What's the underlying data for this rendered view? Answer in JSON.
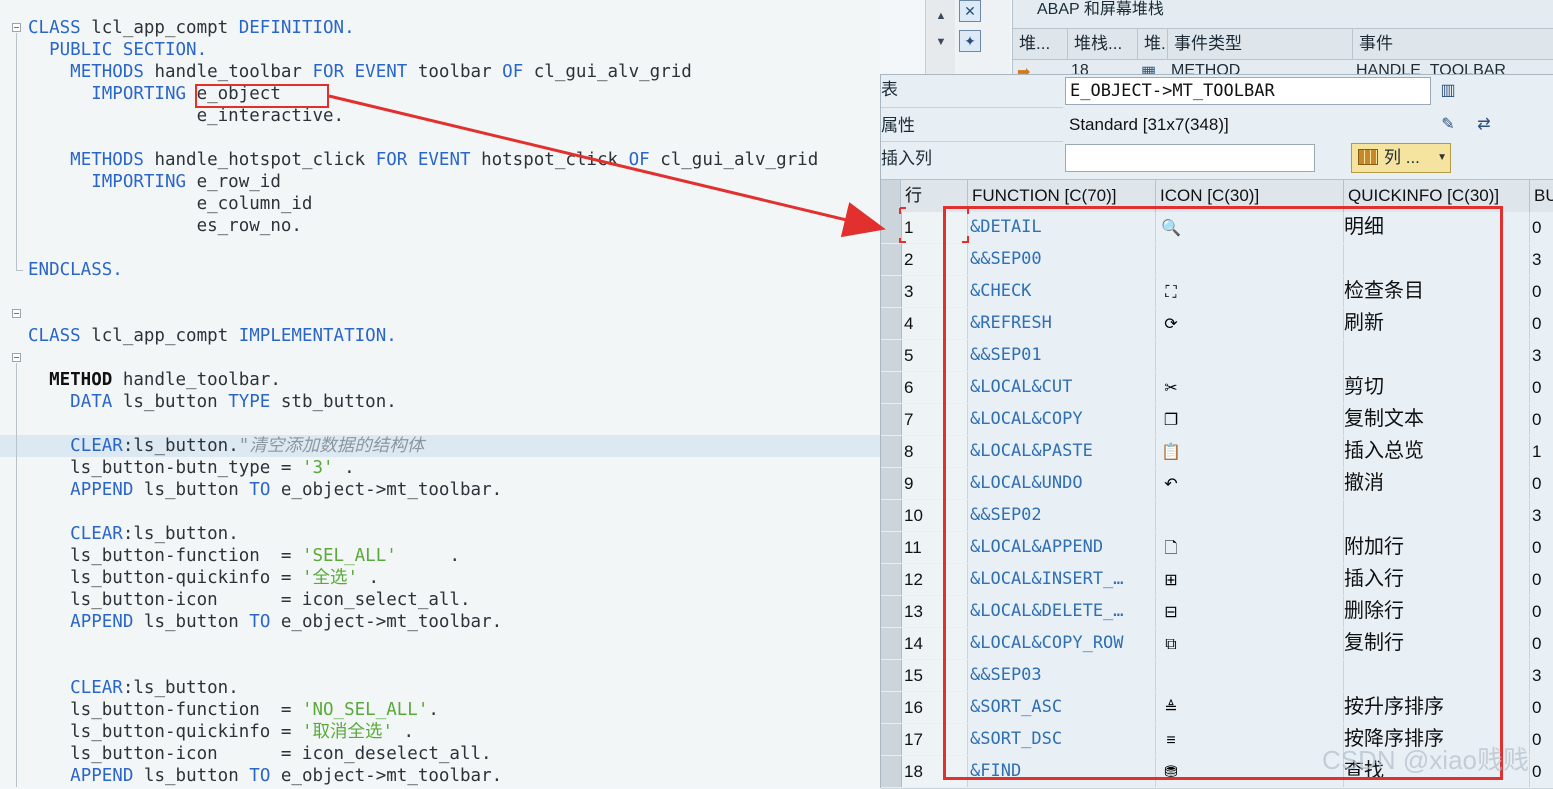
{
  "code": {
    "lines": [
      {
        "parts": [
          [
            "kw",
            "CLASS "
          ],
          [
            "plain",
            "lcl_app_compt "
          ],
          [
            "kw",
            "DEFINITION."
          ]
        ]
      },
      {
        "parts": [
          [
            "plain",
            "  "
          ],
          [
            "kw",
            "PUBLIC SECTION."
          ]
        ]
      },
      {
        "parts": [
          [
            "plain",
            "    "
          ],
          [
            "kw",
            "METHODS "
          ],
          [
            "plain",
            "handle_toolbar "
          ],
          [
            "kw",
            "FOR EVENT "
          ],
          [
            "plain",
            "toolbar "
          ],
          [
            "kw",
            "OF "
          ],
          [
            "plain",
            "cl_gui_alv_grid"
          ]
        ]
      },
      {
        "parts": [
          [
            "plain",
            "      "
          ],
          [
            "kw",
            "IMPORTING "
          ],
          [
            "plain",
            "e_object"
          ]
        ]
      },
      {
        "parts": [
          [
            "plain",
            "                e_interactive."
          ]
        ]
      },
      {
        "parts": [
          [
            "plain",
            ""
          ]
        ]
      },
      {
        "parts": [
          [
            "plain",
            "    "
          ],
          [
            "kw",
            "METHODS "
          ],
          [
            "plain",
            "handle_hotspot_click "
          ],
          [
            "kw",
            "FOR EVENT "
          ],
          [
            "plain",
            "hotspot_click "
          ],
          [
            "kw",
            "OF "
          ],
          [
            "plain",
            "cl_gui_alv_grid"
          ]
        ]
      },
      {
        "parts": [
          [
            "plain",
            "      "
          ],
          [
            "kw",
            "IMPORTING "
          ],
          [
            "plain",
            "e_row_id"
          ]
        ]
      },
      {
        "parts": [
          [
            "plain",
            "                e_column_id"
          ]
        ]
      },
      {
        "parts": [
          [
            "plain",
            "                es_row_no."
          ]
        ]
      },
      {
        "parts": [
          [
            "plain",
            ""
          ]
        ]
      },
      {
        "parts": [
          [
            "kw",
            "ENDCLASS."
          ]
        ]
      },
      {
        "parts": [
          [
            "plain",
            ""
          ]
        ]
      },
      {
        "parts": [
          [
            "plain",
            ""
          ]
        ]
      },
      {
        "parts": [
          [
            "kw",
            "CLASS "
          ],
          [
            "plain",
            "lcl_app_compt "
          ],
          [
            "kw",
            "IMPLEMENTATION."
          ]
        ]
      },
      {
        "parts": [
          [
            "plain",
            ""
          ]
        ]
      },
      {
        "parts": [
          [
            "plain",
            "  "
          ],
          [
            "bold",
            "METHOD "
          ],
          [
            "plain",
            "handle_toolbar."
          ]
        ]
      },
      {
        "parts": [
          [
            "plain",
            "    "
          ],
          [
            "kw",
            "DATA "
          ],
          [
            "plain",
            "ls_button "
          ],
          [
            "kw",
            "TYPE "
          ],
          [
            "plain",
            "stb_button."
          ]
        ]
      },
      {
        "parts": [
          [
            "plain",
            ""
          ]
        ]
      },
      {
        "parts": [
          [
            "plain",
            "    "
          ],
          [
            "kw",
            "CLEAR"
          ],
          [
            "plain",
            ":ls_button."
          ],
          [
            "cmt",
            "\"清空添加数据的结构体"
          ]
        ],
        "hl": true
      },
      {
        "parts": [
          [
            "plain",
            "    ls_button-butn_type = "
          ],
          [
            "str",
            "'3'"
          ],
          [
            "plain",
            " ."
          ]
        ]
      },
      {
        "parts": [
          [
            "plain",
            "    "
          ],
          [
            "kw",
            "APPEND "
          ],
          [
            "plain",
            "ls_button "
          ],
          [
            "kw",
            "TO "
          ],
          [
            "plain",
            "e_object->mt_toolbar."
          ]
        ]
      },
      {
        "parts": [
          [
            "plain",
            ""
          ]
        ]
      },
      {
        "parts": [
          [
            "plain",
            "    "
          ],
          [
            "kw",
            "CLEAR"
          ],
          [
            "plain",
            ":ls_button."
          ]
        ]
      },
      {
        "parts": [
          [
            "plain",
            "    ls_button-function  = "
          ],
          [
            "str",
            "'SEL_ALL'"
          ],
          [
            "plain",
            "     ."
          ]
        ]
      },
      {
        "parts": [
          [
            "plain",
            "    ls_button-quickinfo = "
          ],
          [
            "str",
            "'全选'"
          ],
          [
            "plain",
            " ."
          ]
        ]
      },
      {
        "parts": [
          [
            "plain",
            "    ls_button-icon      = icon_select_all."
          ]
        ]
      },
      {
        "parts": [
          [
            "plain",
            "    "
          ],
          [
            "kw",
            "APPEND "
          ],
          [
            "plain",
            "ls_button "
          ],
          [
            "kw",
            "TO "
          ],
          [
            "plain",
            "e_object->mt_toolbar."
          ]
        ]
      },
      {
        "parts": [
          [
            "plain",
            ""
          ]
        ]
      },
      {
        "parts": [
          [
            "plain",
            ""
          ]
        ]
      },
      {
        "parts": [
          [
            "plain",
            "    "
          ],
          [
            "kw",
            "CLEAR"
          ],
          [
            "plain",
            ":ls_button."
          ]
        ]
      },
      {
        "parts": [
          [
            "plain",
            "    ls_button-function  = "
          ],
          [
            "str",
            "'NO_SEL_ALL'"
          ],
          [
            "plain",
            "."
          ]
        ]
      },
      {
        "parts": [
          [
            "plain",
            "    ls_button-quickinfo = "
          ],
          [
            "str",
            "'取消全选'"
          ],
          [
            "plain",
            " ."
          ]
        ]
      },
      {
        "parts": [
          [
            "plain",
            "    ls_button-icon      = icon_deselect_all."
          ]
        ]
      },
      {
        "parts": [
          [
            "plain",
            "    "
          ],
          [
            "kw",
            "APPEND "
          ],
          [
            "plain",
            "ls_button "
          ],
          [
            "kw",
            "TO "
          ],
          [
            "plain",
            "e_object->mt_toolbar."
          ]
        ]
      }
    ]
  },
  "stack": {
    "title": "ABAP 和屏幕堆栈",
    "headers": [
      "堆...",
      "堆栈...",
      "堆.",
      "事件类型",
      "事件"
    ],
    "row": [
      "18",
      "METHOD",
      "HANDLE_TOOLBAR"
    ]
  },
  "viewer": {
    "label_table": "表",
    "table_name": "E_OBJECT->MT_TOOLBAR",
    "label_attr": "属性",
    "attr_value": "Standard [31x7(348)]",
    "label_insert": "插入列",
    "insert_value": "",
    "cols_button": "列 ...",
    "headers": [
      "行",
      "FUNCTION [C(70)]",
      "ICON [C(30)]",
      "QUICKINFO [C(30)]",
      "BU"
    ],
    "rows": [
      {
        "n": "1",
        "fn": "&DETAIL",
        "icon": "detail-icon",
        "glyph": "🔍",
        "qi": "明细",
        "bu": "0"
      },
      {
        "n": "2",
        "fn": "&&SEP00",
        "icon": "",
        "glyph": "",
        "qi": "",
        "bu": "3"
      },
      {
        "n": "3",
        "fn": "&CHECK",
        "icon": "check-icon",
        "glyph": "⛶",
        "qi": "检查条目",
        "bu": "0"
      },
      {
        "n": "4",
        "fn": "&REFRESH",
        "icon": "refresh-icon",
        "glyph": "⟳",
        "qi": "刷新",
        "bu": "0"
      },
      {
        "n": "5",
        "fn": "&&SEP01",
        "icon": "",
        "glyph": "",
        "qi": "",
        "bu": "3"
      },
      {
        "n": "6",
        "fn": "&LOCAL&CUT",
        "icon": "cut-icon",
        "glyph": "✂",
        "qi": "剪切",
        "bu": "0"
      },
      {
        "n": "7",
        "fn": "&LOCAL&COPY",
        "icon": "copy-icon",
        "glyph": "❐",
        "qi": "复制文本",
        "bu": "0"
      },
      {
        "n": "8",
        "fn": "&LOCAL&PASTE",
        "icon": "paste-icon",
        "glyph": "📋",
        "qi": "插入总览",
        "bu": "1"
      },
      {
        "n": "9",
        "fn": "&LOCAL&UNDO",
        "icon": "undo-icon",
        "glyph": "↶",
        "qi": "撤消",
        "bu": "0"
      },
      {
        "n": "10",
        "fn": "&&SEP02",
        "icon": "",
        "glyph": "",
        "qi": "",
        "bu": "3"
      },
      {
        "n": "11",
        "fn": "&LOCAL&APPEND",
        "icon": "append-row-icon",
        "glyph": "🗋",
        "qi": "附加行",
        "bu": "0"
      },
      {
        "n": "12",
        "fn": "&LOCAL&INSERT_…",
        "icon": "insert-row-icon",
        "glyph": "⊞",
        "qi": "插入行",
        "bu": "0"
      },
      {
        "n": "13",
        "fn": "&LOCAL&DELETE_…",
        "icon": "delete-row-icon",
        "glyph": "⊟",
        "qi": "删除行",
        "bu": "0"
      },
      {
        "n": "14",
        "fn": "&LOCAL&COPY_ROW",
        "icon": "copy-row-icon",
        "glyph": "⧉",
        "qi": "复制行",
        "bu": "0"
      },
      {
        "n": "15",
        "fn": "&&SEP03",
        "icon": "",
        "glyph": "",
        "qi": "",
        "bu": "3"
      },
      {
        "n": "16",
        "fn": "&SORT_ASC",
        "icon": "sort-asc-icon",
        "glyph": "≜",
        "qi": "按升序排序",
        "bu": "0"
      },
      {
        "n": "17",
        "fn": "&SORT_DSC",
        "icon": "sort-desc-icon",
        "glyph": "≡",
        "qi": "按降序排序",
        "bu": "0"
      },
      {
        "n": "18",
        "fn": "&FIND",
        "icon": "find-icon",
        "glyph": "⛃",
        "qi": "查找",
        "bu": "0"
      }
    ]
  },
  "watermark": "CSDN @xiao贱贱",
  "colors": {
    "annotation": "#e2302f",
    "keyword": "#2a66c8",
    "string": "#5aa93b",
    "link": "#2f6fb4"
  }
}
